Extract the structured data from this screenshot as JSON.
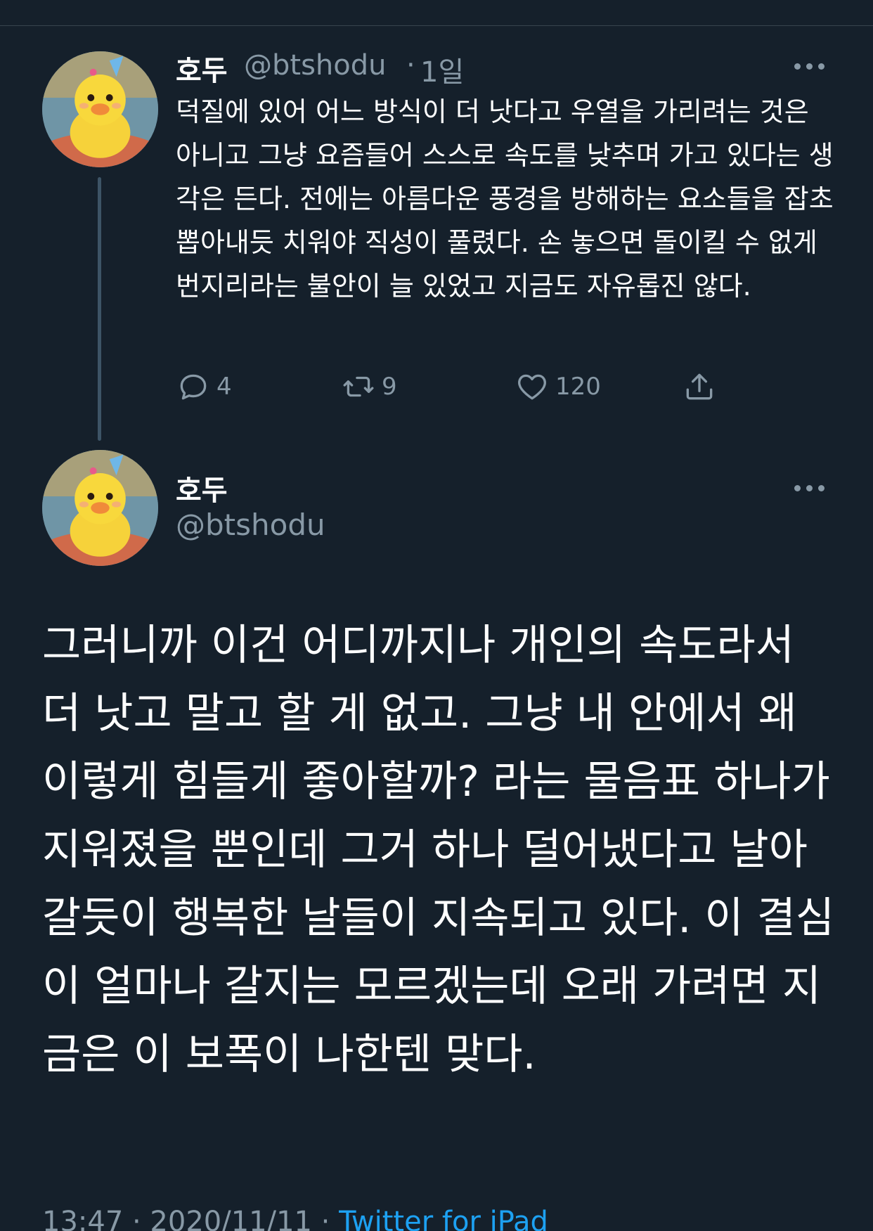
{
  "tweet1": {
    "name": "호두",
    "handle": "@btshodu",
    "separator": "·",
    "time": "1일",
    "text": "덕질에 있어 어느 방식이 더 낫다고 우열을 가리려는 것은 아니고 그냥 요즘들어 스스로 속도를 낮추며 가고 있다는 생각은 든다. 전에는 아름다운 풍경을 방해하는 요소들을 잡초 뽑아내듯 치워야 직성이 풀렸다. 손 놓으면 돌이킬 수 없게 번지리라는 불안이 늘 있었고 지금도 자유롭진 않다.",
    "replies": "4",
    "retweets": "9",
    "likes": "120"
  },
  "tweet2": {
    "name": "호두",
    "handle": "@btshodu",
    "text": "그러니까 이건 어디까지나 개인의 속도라서 더 낫고 말고 할 게 없고. 그냥 내 안에서 왜 이렇게 힘들게 좋아할까? 라는 물음표 하나가 지워졌을 뿐인데 그거 하나 덜어냈다고 날아갈듯이 행복한 날들이 지속되고 있다. 이 결심이 얼마나 갈지는 모르겠는데 오래 가려면 지금은 이 보폭이 나한텐 맞다.",
    "timestamp": "13:47 · 2020/11/11 · ",
    "source": "Twitter for iPad"
  },
  "colors": {
    "background": "#15202b",
    "secondary_text": "#8899a6",
    "link": "#1da1f2",
    "divider": "#38444d"
  },
  "icons": {
    "reply": "speech-bubble",
    "retweet": "retweet-arrows",
    "like": "heart",
    "share": "upload-arrow",
    "more": "three-dots"
  }
}
